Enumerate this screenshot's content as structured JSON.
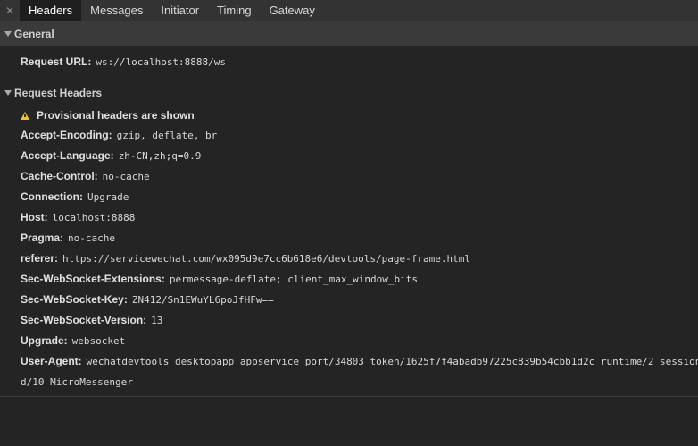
{
  "tabs": {
    "close_glyph": "✕",
    "items": [
      "Headers",
      "Messages",
      "Initiator",
      "Timing",
      "Gateway"
    ],
    "active": "Headers"
  },
  "general": {
    "title": "General",
    "request_url_key": "Request URL:",
    "request_url_value": "ws://localhost:8888/ws"
  },
  "request_headers": {
    "title": "Request Headers",
    "warning": "Provisional headers are shown",
    "rows": [
      {
        "k": "Accept-Encoding:",
        "v": "gzip, deflate, br"
      },
      {
        "k": "Accept-Language:",
        "v": "zh-CN,zh;q=0.9"
      },
      {
        "k": "Cache-Control:",
        "v": "no-cache"
      },
      {
        "k": "Connection:",
        "v": "Upgrade"
      },
      {
        "k": "Host:",
        "v": "localhost:8888"
      },
      {
        "k": "Pragma:",
        "v": "no-cache"
      },
      {
        "k": "referer:",
        "v": "https://servicewechat.com/wx095d9e7cc6b618e6/devtools/page-frame.html"
      },
      {
        "k": "Sec-WebSocket-Extensions:",
        "v": "permessage-deflate; client_max_window_bits"
      },
      {
        "k": "Sec-WebSocket-Key:",
        "v": "ZN412/Sn1EWuYL6poJfHFw=="
      },
      {
        "k": "Sec-WebSocket-Version:",
        "v": "13"
      },
      {
        "k": "Upgrade:",
        "v": "websocket"
      }
    ],
    "user_agent_key": "User-Agent:",
    "user_agent_line1": "wechatdevtools desktopapp appservice port/34803 token/1625f7f4abadb97225c839b54cbb1d2c runtime/2 session",
    "user_agent_line2": "d/10 MicroMessenger"
  },
  "colors": {
    "background": "#242424",
    "tabbar": "#333333",
    "active_tab": "#1e1e1e",
    "general_header": "#3a3a3a",
    "warning": "#f2c12e"
  }
}
